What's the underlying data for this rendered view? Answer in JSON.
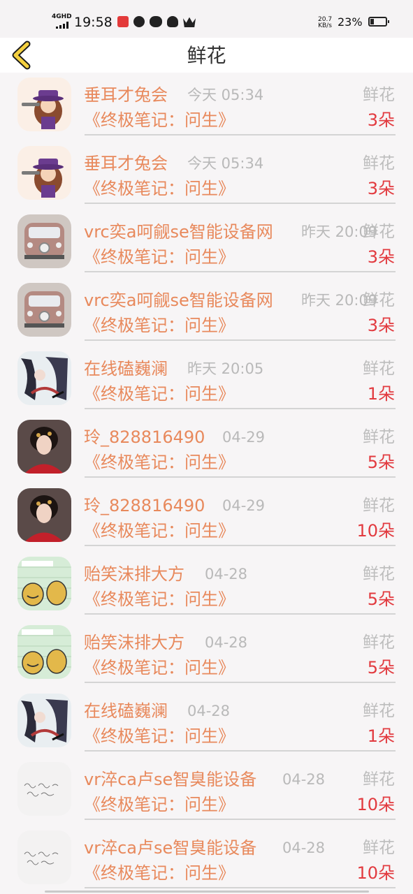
{
  "status_bar": {
    "network": "4GHD",
    "time": "19:58",
    "speed_value": "20.7",
    "speed_unit": "KB/s",
    "battery": "23%",
    "icons": [
      "app-icon",
      "chat-icon",
      "wechat-icon",
      "qq-icon",
      "crown-icon"
    ]
  },
  "header": {
    "title": "鲜花",
    "back_icon": "chevron-left-icon"
  },
  "colors": {
    "accent": "#e8895c",
    "count": "#e23a3f",
    "muted": "#b9b9b9",
    "back_icon": "#f4d03f"
  },
  "records": [
    {
      "user": "垂耳才兔会",
      "time": "今天 05:34",
      "gift": "鲜花",
      "work": "《终极笔记：问生》",
      "count": "3朵",
      "avatar": "girl-hat"
    },
    {
      "user": "垂耳才兔会",
      "time": "今天 05:34",
      "gift": "鲜花",
      "work": "《终极笔记：问生》",
      "count": "3朵",
      "avatar": "girl-hat"
    },
    {
      "user": "vrc奕a呵觎se智能设备网",
      "time": "昨天 20:09",
      "gift": "鲜花",
      "work": "《终极笔记：问生》",
      "count": "3朵",
      "avatar": "van"
    },
    {
      "user": "vrc奕a呵觎se智能设备网",
      "time": "昨天 20:09",
      "gift": "鲜花",
      "work": "《终极笔记：问生》",
      "count": "3朵",
      "avatar": "van"
    },
    {
      "user": "在线磕巍澜",
      "time": "昨天 20:05",
      "gift": "鲜花",
      "work": "《终极笔记：问生》",
      "count": "1朵",
      "avatar": "drawing"
    },
    {
      "user": "玲_828816490",
      "time": "04-29",
      "gift": "鲜花",
      "work": "《终极笔记：问生》",
      "count": "5朵",
      "avatar": "woman"
    },
    {
      "user": "玲_828816490",
      "time": "04-29",
      "gift": "鲜花",
      "work": "《终极笔记：问生》",
      "count": "10朵",
      "avatar": "woman"
    },
    {
      "user": "贻笑沫排大方",
      "time": "04-28",
      "gift": "鲜花",
      "work": "《终极笔记：问生》",
      "count": "5朵",
      "avatar": "cartoon"
    },
    {
      "user": "贻笑沫排大方",
      "time": "04-28",
      "gift": "鲜花",
      "work": "《终极笔记：问生》",
      "count": "5朵",
      "avatar": "cartoon"
    },
    {
      "user": "在线磕巍澜",
      "time": "04-28",
      "gift": "鲜花",
      "work": "《终极笔记：问生》",
      "count": "1朵",
      "avatar": "drawing"
    },
    {
      "user": "vr淬ca卢se智臭能设备",
      "time": "04-28",
      "gift": "鲜花",
      "work": "《终极笔记：问生》",
      "count": "10朵",
      "avatar": "handwriting"
    },
    {
      "user": "vr淬ca卢se智臭能设备",
      "time": "04-28",
      "gift": "鲜花",
      "work": "《终极笔记：问生》",
      "count": "10朵",
      "avatar": "handwriting"
    }
  ]
}
